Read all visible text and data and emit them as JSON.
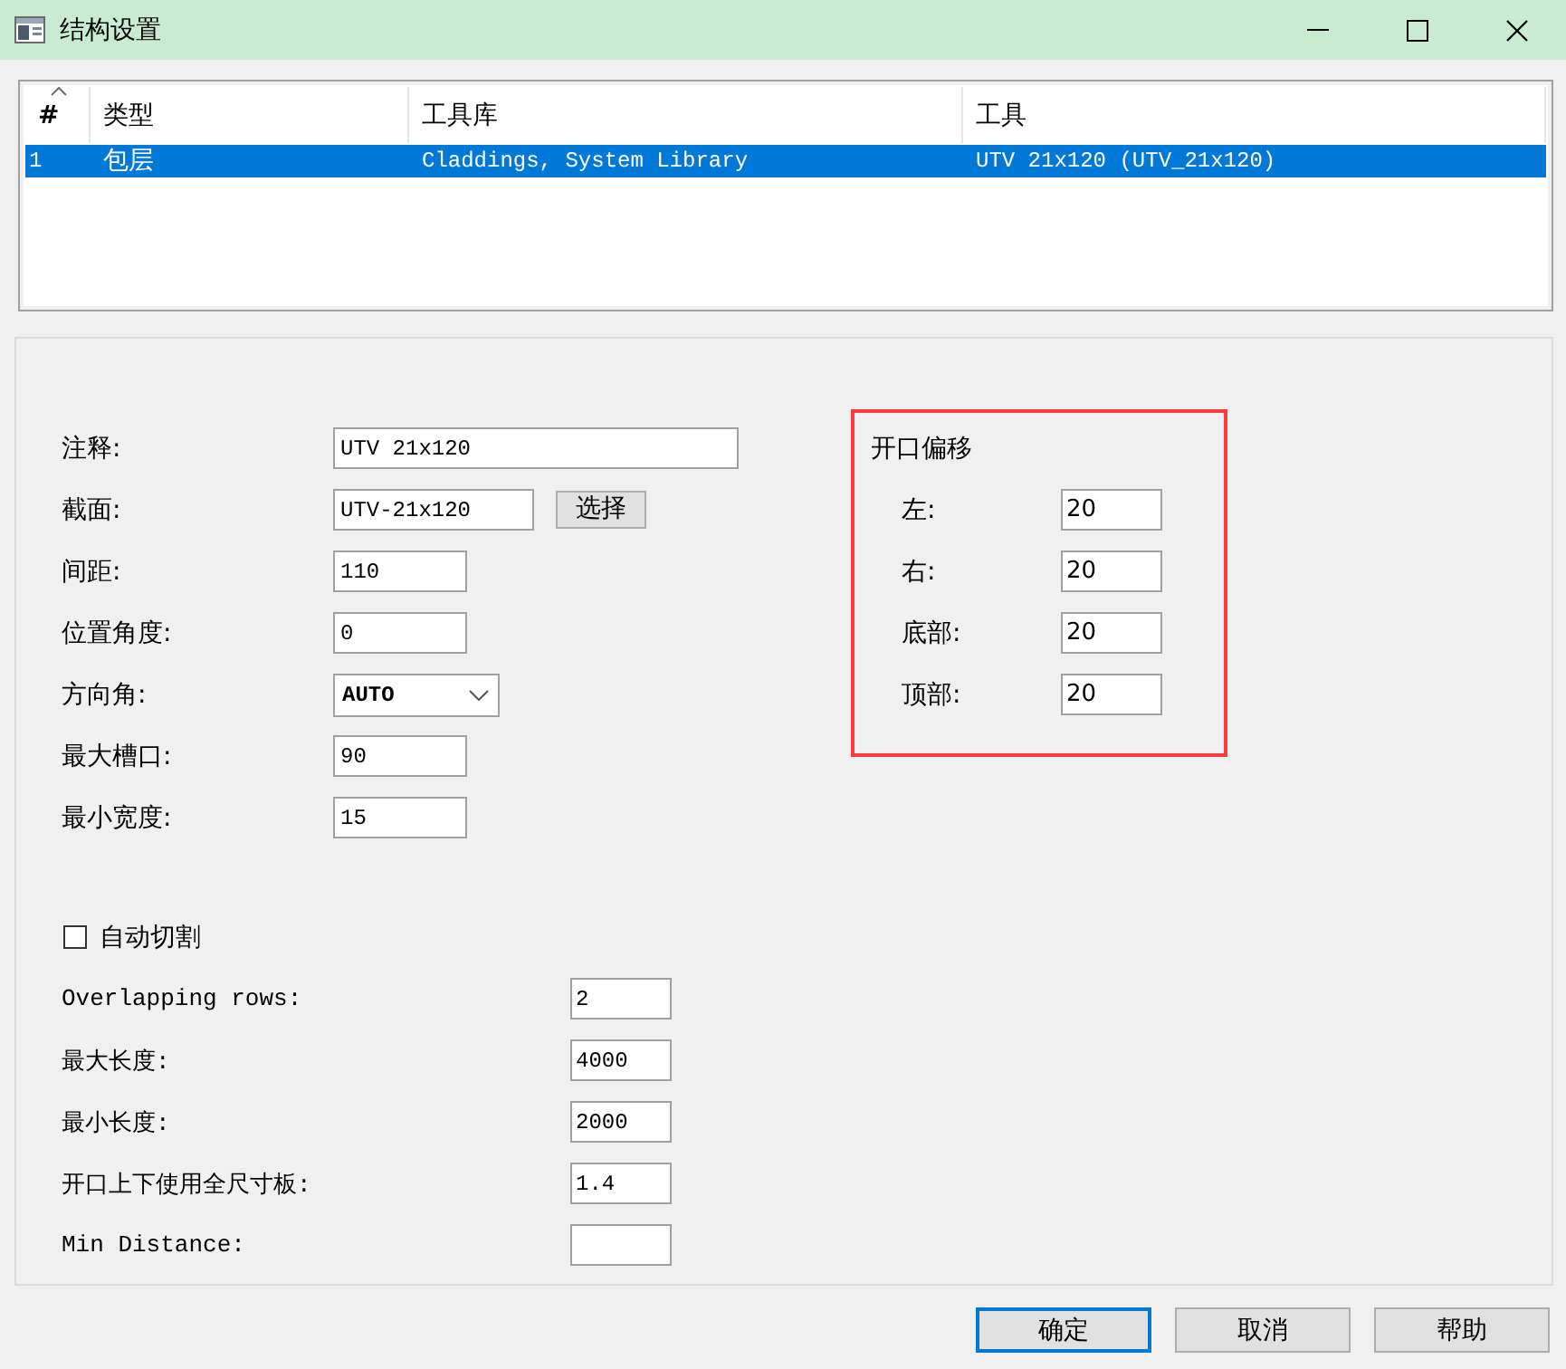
{
  "window": {
    "title": "结构设置"
  },
  "table": {
    "columns": [
      {
        "label": "#",
        "sorted": true
      },
      {
        "label": "类型",
        "sorted": false
      },
      {
        "label": "工具库",
        "sorted": false
      },
      {
        "label": "工具",
        "sorted": false
      }
    ],
    "rows": [
      {
        "cells": [
          "1",
          "包层",
          "Claddings, System Library",
          "UTV 21x120 (UTV_21x120)"
        ],
        "selected": true
      }
    ]
  },
  "properties": [
    {
      "kind": "long-text",
      "label": "注释:",
      "value": "UTV 21x120"
    },
    {
      "kind": "picker",
      "label": "截面:",
      "value": "UTV-21x120",
      "button": "选择"
    },
    {
      "kind": "text",
      "label": "间距:",
      "value": "110"
    },
    {
      "kind": "text",
      "label": "位置角度:",
      "value": "0"
    },
    {
      "kind": "dropdown",
      "label": "方向角:",
      "value": "AUTO"
    },
    {
      "kind": "text",
      "label": "最大槽口:",
      "value": "90"
    },
    {
      "kind": "text",
      "label": "最小宽度:",
      "value": "15"
    }
  ],
  "opening_offset": {
    "title": "开口偏移",
    "highlighted": true,
    "fields": [
      {
        "label": "左:",
        "value": "20"
      },
      {
        "label": "右:",
        "value": "20"
      },
      {
        "label": "底部:",
        "value": "20"
      },
      {
        "label": "顶部:",
        "value": "20"
      }
    ]
  },
  "auto_cut": {
    "label": "自动切割",
    "checked": false
  },
  "cut_fields": [
    {
      "label": "Overlapping rows:",
      "value": "2"
    },
    {
      "label": "最大长度:",
      "value": "4000"
    },
    {
      "label": "最小长度:",
      "value": "2000"
    },
    {
      "label": "开口上下使用全尺寸板:",
      "value": "1.4"
    },
    {
      "label": "Min Distance:"
    }
  ],
  "buttons": [
    {
      "label": "确定",
      "focused": true
    },
    {
      "label": "取消",
      "focused": false
    },
    {
      "label": "帮助",
      "focused": false
    }
  ]
}
